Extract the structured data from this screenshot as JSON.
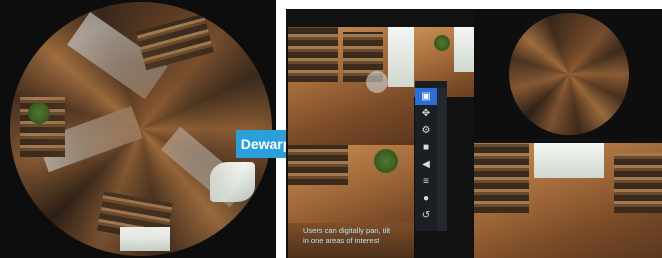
{
  "arrow": {
    "label": "Dewarp",
    "color": "#2a9fd8"
  },
  "toolbar": {
    "icons": [
      "camera-icon",
      "ptz-icon",
      "settings-icon",
      "video-icon",
      "volume-icon",
      "list-icon",
      "toggle-icon",
      "refresh-icon"
    ],
    "glyphs": [
      "▣",
      "✥",
      "⚙",
      "■",
      "◀",
      "≡",
      "●",
      "↺"
    ]
  },
  "caption": {
    "line1": "Users can digitally pan, tilt",
    "line2": "in one areas of interest"
  }
}
